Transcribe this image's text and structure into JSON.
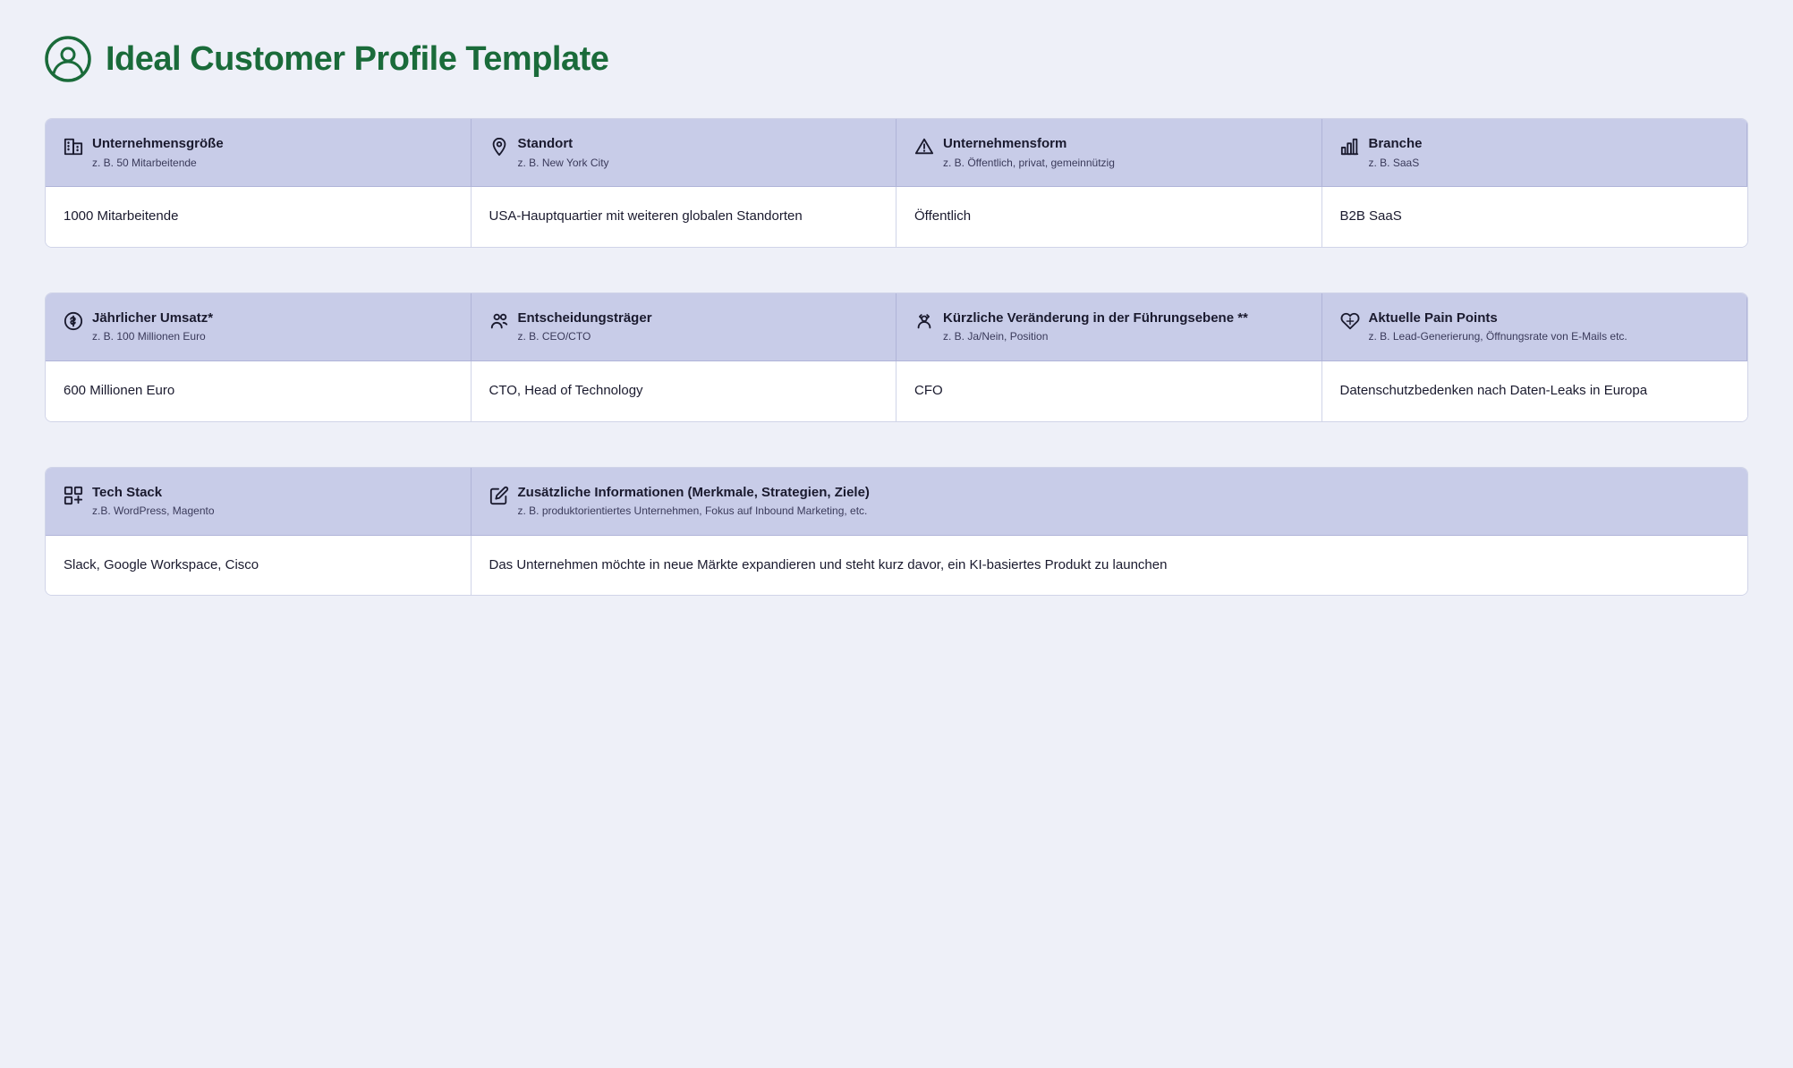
{
  "page": {
    "title": "Ideal Customer Profile Template"
  },
  "tables": [
    {
      "id": "table1",
      "columns": 4,
      "headers": [
        {
          "icon": "building-icon",
          "title": "Unternehmensgröße",
          "subtitle": "z. B. 50 Mitarbeitende"
        },
        {
          "icon": "location-icon",
          "title": "Standort",
          "subtitle": "z. B. New York City"
        },
        {
          "icon": "company-type-icon",
          "title": "Unternehmensform",
          "subtitle": "z. B. Öffentlich, privat, gemeinnützig"
        },
        {
          "icon": "chart-icon",
          "title": "Branche",
          "subtitle": "z. B. SaaS"
        }
      ],
      "row": [
        "1000 Mitarbeitende",
        "USA-Hauptquartier mit weiteren globalen Standorten",
        "Öffentlich",
        "B2B SaaS"
      ]
    },
    {
      "id": "table2",
      "columns": 4,
      "headers": [
        {
          "icon": "dollar-icon",
          "title": "Jährlicher Umsatz*",
          "subtitle": "z. B. 100 Millionen Euro"
        },
        {
          "icon": "people-icon",
          "title": "Entscheidungsträger",
          "subtitle": "z. B. CEO/CTO"
        },
        {
          "icon": "change-icon",
          "title": "Kürzliche Veränderung in der Führungsebene **",
          "subtitle": "z. B. Ja/Nein, Position"
        },
        {
          "icon": "heart-icon",
          "title": "Aktuelle Pain Points",
          "subtitle": "z. B. Lead-Generierung, Öffnungsrate von E-Mails etc."
        }
      ],
      "row": [
        "600 Millionen Euro",
        "CTO, Head of Technology",
        "CFO",
        "Datenschutzbedenken nach Daten-Leaks in Europa"
      ]
    },
    {
      "id": "table3",
      "columns": 2,
      "headers": [
        {
          "icon": "tech-icon",
          "title": "Tech Stack",
          "subtitle": "z.B. WordPress, Magento"
        },
        {
          "icon": "pencil-icon",
          "title": "Zusätzliche Informationen (Merkmale, Strategien, Ziele)",
          "subtitle": "z. B. produktorientiertes Unternehmen, Fokus auf Inbound Marketing, etc."
        }
      ],
      "row": [
        "Slack, Google Workspace, Cisco",
        "Das Unternehmen möchte in neue Märkte expandieren und steht kurz davor, ein KI-basiertes Produkt zu launchen"
      ]
    }
  ]
}
